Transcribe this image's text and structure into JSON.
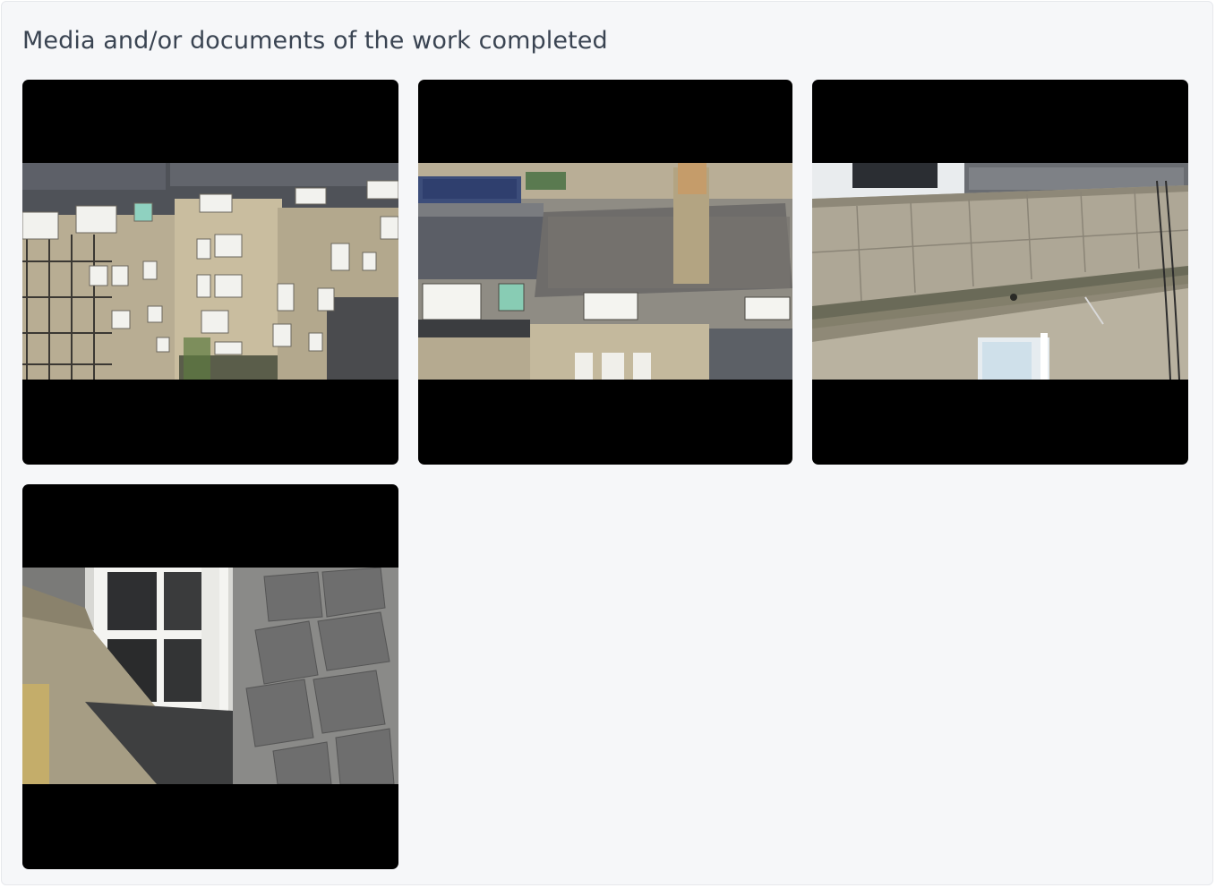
{
  "section": {
    "title": "Media and/or documents of the work completed"
  },
  "media": [
    {
      "kind": "image",
      "subject": "building-rear-facade-with-scaffolding"
    },
    {
      "kind": "image",
      "subject": "rooftops-with-chimney-and-dormers"
    },
    {
      "kind": "image",
      "subject": "stone-parapet-close-up"
    },
    {
      "kind": "image",
      "subject": "dormer-window-and-slate-roof"
    }
  ],
  "colors": {
    "panel_background": "#f6f7f9",
    "title_text": "#3a4452",
    "letterbox": "#000000"
  }
}
